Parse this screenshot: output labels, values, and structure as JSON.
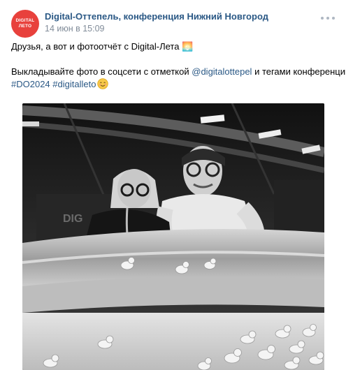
{
  "post": {
    "author": "Digital-Оттепель, конференция Нижний Новгород",
    "date": "14 июн в 15:09",
    "avatar": {
      "line1": "DIGITAL",
      "line2": "ЛЕТО",
      "color": "#e8413c"
    },
    "more_icon": "ellipsis-horizontal-icon",
    "text": {
      "line1": "Друзья, а вот и фотоотчёт с Digital-Лета 🌅",
      "line2_prefix": "Выкладывайте фото в соцсети с отметкой ",
      "mention": "@digitalottepel",
      "line2_suffix": " и тегами конференции:",
      "hashtag1": "#DO2024",
      "hashtag2": "#digitalleto",
      "emoji": "blush-emoji"
    },
    "photo": {
      "description": "black-and-white-conference-photo",
      "sign_text": "DIG"
    },
    "colors": {
      "link": "#2a5885",
      "meta": "#818c99",
      "text": "#000000"
    }
  }
}
